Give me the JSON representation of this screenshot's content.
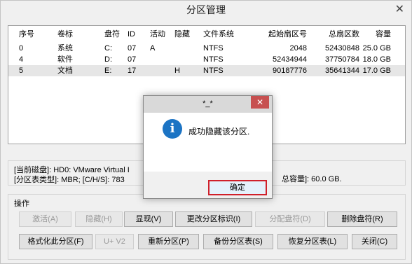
{
  "window": {
    "title": "分区管理",
    "close_glyph": "✕"
  },
  "table": {
    "headers": [
      "序号",
      "卷标",
      "盘符",
      "ID",
      "活动",
      "隐藏",
      "文件系统",
      "起始扇区号",
      "总扇区数",
      "容量"
    ],
    "rows": [
      [
        "0",
        "系统",
        "C:",
        "07",
        "A",
        "",
        "NTFS",
        "2048",
        "52430848",
        "25.0 GB"
      ],
      [
        "4",
        "软件",
        "D:",
        "07",
        "",
        "",
        "NTFS",
        "52434944",
        "37750784",
        "18.0 GB"
      ],
      [
        "5",
        "文档",
        "E:",
        "17",
        "",
        "H",
        "NTFS",
        "90187776",
        "35641344",
        "17.0 GB"
      ]
    ],
    "selected_row": 2
  },
  "disk_info": {
    "line1": "[当前磁盘]:      HD0: VMware Virtual I",
    "line2": "[分区表类型]:   MBR;       [C/H/S]: 783",
    "capacity": "总容量]: 60.0 GB."
  },
  "operations": {
    "label": "操作",
    "row1": [
      "激活(A)",
      "隐藏(H)",
      "显现(V)",
      "更改分区标识(I)",
      "分配盘符(D)",
      "删除盘符(R)"
    ],
    "row2": [
      "格式化此分区(F)",
      "U+ V2",
      "重新分区(P)",
      "备份分区表(S)",
      "恢复分区表(L)",
      "关闭(C)"
    ]
  },
  "dialog": {
    "title": "*_*",
    "close_glyph": "✕",
    "icon": "info-icon",
    "icon_glyph": "i",
    "message": "成功隐藏该分区.",
    "ok_label": "确定",
    "ok_highlight_color": "#d0202a"
  }
}
